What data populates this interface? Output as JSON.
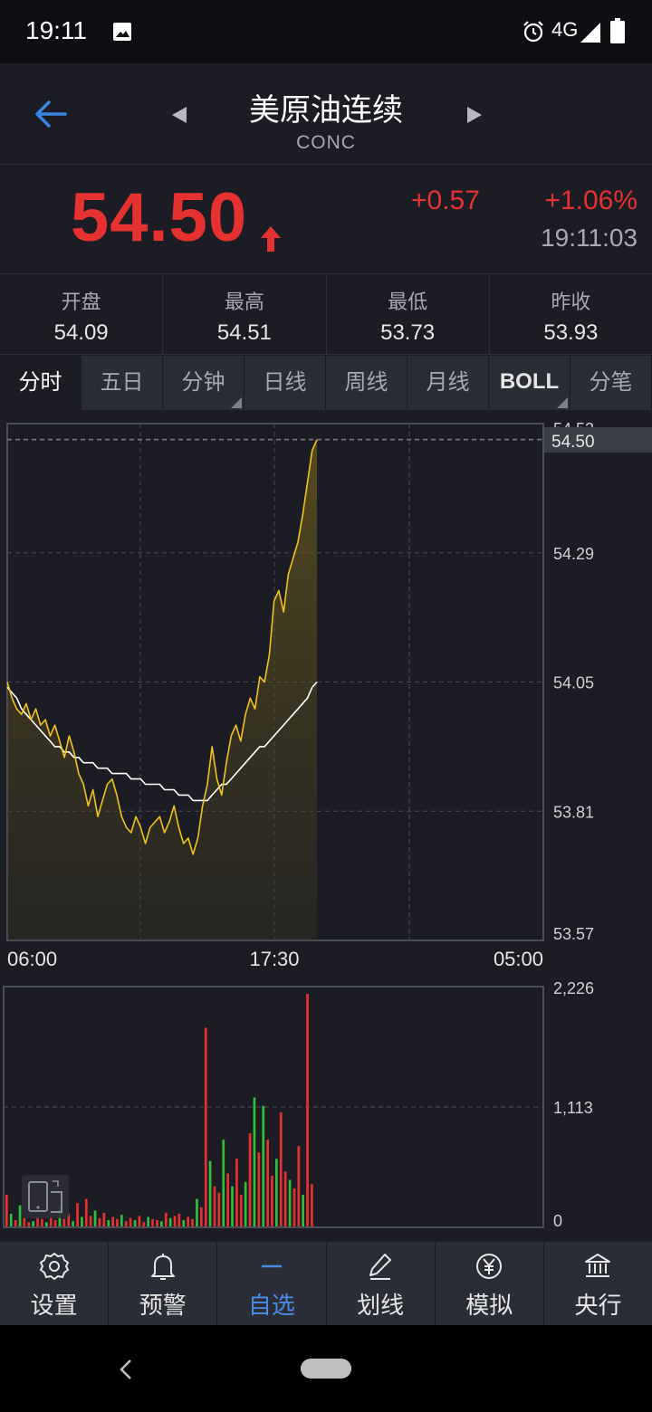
{
  "statusbar": {
    "time": "19:11",
    "network": "4G"
  },
  "header": {
    "title": "美原油连续",
    "subtitle": "CONC"
  },
  "quote": {
    "price": "54.50",
    "change": "+0.57",
    "change_pct": "+1.06%",
    "time": "19:11:03"
  },
  "stats": [
    {
      "label": "开盘",
      "value": "54.09"
    },
    {
      "label": "最高",
      "value": "54.51"
    },
    {
      "label": "最低",
      "value": "53.73"
    },
    {
      "label": "昨收",
      "value": "53.93"
    }
  ],
  "tabs": [
    "分时",
    "五日",
    "分钟",
    "日线",
    "周线",
    "月线",
    "BOLL",
    "分笔"
  ],
  "colors": {
    "up": "#e5312f",
    "down": "#2fbf3a",
    "price_line": "#f2c21b",
    "avg_line": "#ffffff",
    "accent": "#4b8ae6"
  },
  "chart_data": {
    "type": "line",
    "price_axis_labels": [
      "54.53",
      "54.29",
      "54.05",
      "53.81",
      "53.57"
    ],
    "current_price_label": "54.50",
    "ylim": [
      53.57,
      54.53
    ],
    "time_labels": [
      "06:00",
      "17:30",
      "05:00"
    ],
    "series": [
      {
        "values": [
          54.05,
          54.02,
          54.0,
          53.99,
          54.01,
          53.98,
          54.0,
          53.97,
          53.98,
          53.95,
          53.97,
          53.94,
          53.91,
          53.95,
          53.92,
          53.88,
          53.86,
          53.82,
          53.85,
          53.8,
          53.83,
          53.86,
          53.87,
          53.84,
          53.8,
          53.78,
          53.77,
          53.8,
          53.78,
          53.75,
          53.78,
          53.79,
          53.8,
          53.77,
          53.79,
          53.82,
          53.78,
          53.75,
          53.76,
          53.73,
          53.76,
          53.82,
          53.86,
          53.93,
          53.87,
          53.84,
          53.9,
          53.95,
          53.97,
          53.94,
          53.99,
          54.02,
          54.0,
          54.06,
          54.05,
          54.1,
          54.2,
          54.22,
          54.18,
          54.25,
          54.28,
          54.31,
          54.36,
          54.42,
          54.48,
          54.5
        ]
      },
      {
        "values": [
          54.04,
          54.03,
          54.02,
          54.0,
          53.99,
          53.98,
          53.97,
          53.96,
          53.95,
          53.94,
          53.93,
          53.93,
          53.92,
          53.92,
          53.91,
          53.91,
          53.9,
          53.9,
          53.9,
          53.89,
          53.89,
          53.89,
          53.88,
          53.88,
          53.88,
          53.88,
          53.87,
          53.87,
          53.87,
          53.86,
          53.86,
          53.86,
          53.86,
          53.85,
          53.85,
          53.85,
          53.84,
          53.84,
          53.84,
          53.83,
          53.83,
          53.83,
          53.83,
          53.84,
          53.85,
          53.86,
          53.86,
          53.87,
          53.88,
          53.89,
          53.9,
          53.91,
          53.92,
          53.93,
          53.93,
          53.94,
          53.95,
          53.96,
          53.97,
          53.98,
          53.99,
          54.0,
          54.01,
          54.02,
          54.04,
          54.05
        ]
      }
    ],
    "volume": {
      "axis_labels": [
        "2,226",
        "1,113",
        "0"
      ],
      "ylim": [
        0,
        2226
      ],
      "bars": [
        {
          "v": 300,
          "c": "up"
        },
        {
          "v": 120,
          "c": "down"
        },
        {
          "v": 60,
          "c": "up"
        },
        {
          "v": 200,
          "c": "down"
        },
        {
          "v": 80,
          "c": "up"
        },
        {
          "v": 40,
          "c": "up"
        },
        {
          "v": 50,
          "c": "down"
        },
        {
          "v": 90,
          "c": "up"
        },
        {
          "v": 70,
          "c": "up"
        },
        {
          "v": 40,
          "c": "down"
        },
        {
          "v": 110,
          "c": "up"
        },
        {
          "v": 60,
          "c": "up"
        },
        {
          "v": 180,
          "c": "down"
        },
        {
          "v": 70,
          "c": "up"
        },
        {
          "v": 120,
          "c": "up"
        },
        {
          "v": 50,
          "c": "down"
        },
        {
          "v": 220,
          "c": "up"
        },
        {
          "v": 90,
          "c": "down"
        },
        {
          "v": 260,
          "c": "up"
        },
        {
          "v": 100,
          "c": "up"
        },
        {
          "v": 150,
          "c": "down"
        },
        {
          "v": 80,
          "c": "up"
        },
        {
          "v": 130,
          "c": "up"
        },
        {
          "v": 60,
          "c": "down"
        },
        {
          "v": 90,
          "c": "up"
        },
        {
          "v": 70,
          "c": "up"
        },
        {
          "v": 110,
          "c": "down"
        },
        {
          "v": 50,
          "c": "up"
        },
        {
          "v": 80,
          "c": "up"
        },
        {
          "v": 60,
          "c": "down"
        },
        {
          "v": 100,
          "c": "up"
        },
        {
          "v": 40,
          "c": "up"
        },
        {
          "v": 90,
          "c": "down"
        },
        {
          "v": 70,
          "c": "up"
        },
        {
          "v": 60,
          "c": "up"
        },
        {
          "v": 50,
          "c": "down"
        },
        {
          "v": 130,
          "c": "up"
        },
        {
          "v": 80,
          "c": "down"
        },
        {
          "v": 100,
          "c": "up"
        },
        {
          "v": 120,
          "c": "up"
        },
        {
          "v": 60,
          "c": "down"
        },
        {
          "v": 90,
          "c": "up"
        },
        {
          "v": 70,
          "c": "up"
        },
        {
          "v": 260,
          "c": "down"
        },
        {
          "v": 180,
          "c": "up"
        },
        {
          "v": 1880,
          "c": "up"
        },
        {
          "v": 620,
          "c": "down"
        },
        {
          "v": 380,
          "c": "up"
        },
        {
          "v": 320,
          "c": "up"
        },
        {
          "v": 820,
          "c": "down"
        },
        {
          "v": 500,
          "c": "up"
        },
        {
          "v": 380,
          "c": "down"
        },
        {
          "v": 640,
          "c": "up"
        },
        {
          "v": 300,
          "c": "up"
        },
        {
          "v": 420,
          "c": "down"
        },
        {
          "v": 880,
          "c": "up"
        },
        {
          "v": 1220,
          "c": "down"
        },
        {
          "v": 700,
          "c": "up"
        },
        {
          "v": 1140,
          "c": "down"
        },
        {
          "v": 820,
          "c": "up"
        },
        {
          "v": 480,
          "c": "up"
        },
        {
          "v": 640,
          "c": "down"
        },
        {
          "v": 1080,
          "c": "up"
        },
        {
          "v": 520,
          "c": "up"
        },
        {
          "v": 440,
          "c": "down"
        },
        {
          "v": 360,
          "c": "up"
        },
        {
          "v": 760,
          "c": "up"
        },
        {
          "v": 300,
          "c": "down"
        },
        {
          "v": 2200,
          "c": "up"
        },
        {
          "v": 400,
          "c": "up"
        }
      ]
    }
  },
  "bottomnav": [
    {
      "label": "设置",
      "icon": "settings-icon"
    },
    {
      "label": "预警",
      "icon": "bell-icon"
    },
    {
      "label": "自选",
      "icon": "dash-icon"
    },
    {
      "label": "划线",
      "icon": "pen-icon"
    },
    {
      "label": "模拟",
      "icon": "yen-icon"
    },
    {
      "label": "央行",
      "icon": "bank-icon"
    }
  ]
}
